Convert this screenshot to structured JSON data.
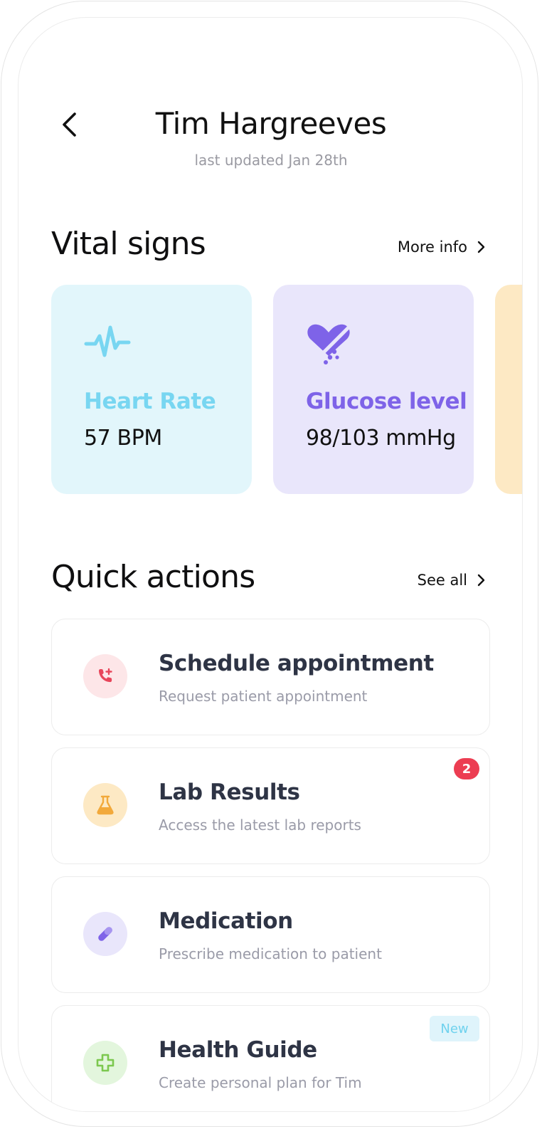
{
  "header": {
    "title": "Tim Hargreeves",
    "subtitle": "last updated Jan 28th"
  },
  "vitals": {
    "section_title": "Vital signs",
    "more_label": "More info",
    "cards": [
      {
        "label": "Heart Rate",
        "value": "57 BPM",
        "icon": "heartbeat-icon",
        "bg": "#e2f6fb",
        "accent": "#78d6f1"
      },
      {
        "label": "Glucose level",
        "value": "98/103 mmHg",
        "icon": "heart-drop-icon",
        "bg": "#e9e6fb",
        "accent": "#7e63e8"
      },
      {
        "bg": "#fde9c4"
      }
    ]
  },
  "quick_actions": {
    "section_title": "Quick actions",
    "see_all_label": "See all",
    "items": [
      {
        "title": "Schedule appointment",
        "subtitle": "Request patient appointment",
        "icon": "phone-plus-icon",
        "circle": "#fde6e8",
        "color": "#e8455a"
      },
      {
        "title": "Lab Results",
        "subtitle": "Access the latest lab reports",
        "icon": "flask-icon",
        "circle": "#fde9c4",
        "color": "#f2a93b",
        "badge": "2"
      },
      {
        "title": "Medication",
        "subtitle": "Prescribe medication to patient",
        "icon": "pill-icon",
        "circle": "#e9e6fb",
        "color": "#7e63e8"
      },
      {
        "title": "Health Guide",
        "subtitle": "Create personal plan for Tim",
        "icon": "plus-cross-icon",
        "circle": "#e3f6dd",
        "color": "#7cc84f",
        "tag": "New"
      }
    ]
  }
}
